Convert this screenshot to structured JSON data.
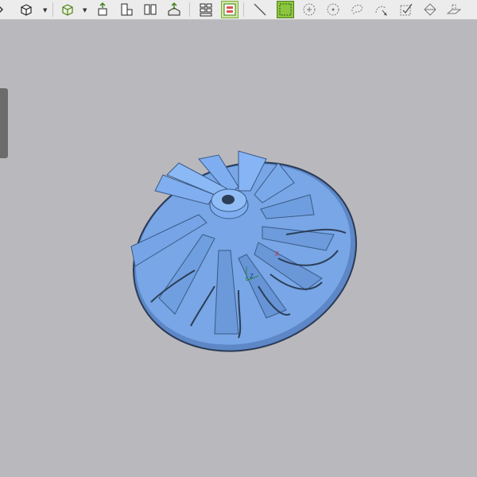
{
  "toolbar": {
    "buttons": [
      {
        "name": "view-cube-front-icon"
      },
      {
        "name": "view-iso-cube-icon"
      },
      {
        "name": "wire-cube-icon"
      },
      {
        "name": "align-top-icon"
      },
      {
        "name": "align-bottom-icon"
      },
      {
        "name": "mirror-icon"
      },
      {
        "name": "section-plane-icon"
      },
      {
        "name": "grid-layout-icon"
      },
      {
        "name": "split-layout-icon"
      },
      {
        "name": "line-select-icon"
      },
      {
        "name": "rect-select-icon"
      },
      {
        "name": "circle-select-icon"
      },
      {
        "name": "circle-plus-select-icon"
      },
      {
        "name": "lasso-select-icon"
      },
      {
        "name": "paint-select-icon"
      },
      {
        "name": "box-check-icon"
      },
      {
        "name": "surface-select-icon"
      },
      {
        "name": "plane-select-icon"
      }
    ]
  },
  "viewport": {
    "model_name": "impeller",
    "model_color": "#6f9ee0"
  },
  "triad": {
    "x_label": "X",
    "z_label": "Z"
  }
}
